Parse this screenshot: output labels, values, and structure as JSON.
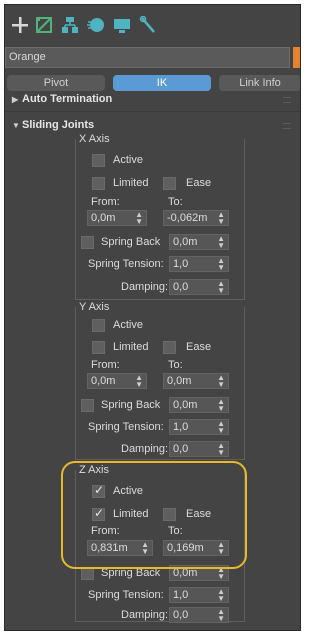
{
  "toolbar": {
    "icons": [
      "create-plus-icon",
      "modify-icon",
      "hierarchy-icon",
      "motion-icon",
      "display-icon",
      "utilities-wrench-icon"
    ]
  },
  "object": {
    "name": "Orange",
    "color": "#e5822d"
  },
  "tabs": [
    {
      "label": "Pivot"
    },
    {
      "label": "IK"
    },
    {
      "label": "Link Info"
    }
  ],
  "rollouts": {
    "auto_termination": {
      "title": "Auto Termination"
    },
    "sliding_joints": {
      "title": "Sliding Joints"
    }
  },
  "x_axis": {
    "title": "X Axis",
    "active_label": "Active",
    "limited_label": "Limited",
    "ease_label": "Ease",
    "from_label": "From:",
    "to_label": "To:",
    "from_value": "0,0m",
    "to_value": "-0,062m",
    "spring_back_label": "Spring Back",
    "spring_back_value": "0,0m",
    "spring_tension_label": "Spring Tension:",
    "spring_tension_value": "1,0",
    "damping_label": "Damping:",
    "damping_value": "0,0"
  },
  "y_axis": {
    "title": "Y Axis",
    "active_label": "Active",
    "limited_label": "Limited",
    "ease_label": "Ease",
    "from_label": "From:",
    "to_label": "To:",
    "from_value": "0,0m",
    "to_value": "0,0m",
    "spring_back_label": "Spring Back",
    "spring_back_value": "0,0m",
    "spring_tension_label": "Spring Tension:",
    "spring_tension_value": "1,0",
    "damping_label": "Damping:",
    "damping_value": "0,0"
  },
  "z_axis": {
    "title": "Z Axis",
    "active_label": "Active",
    "active_checked": true,
    "limited_label": "Limited",
    "limited_checked": true,
    "ease_label": "Ease",
    "from_label": "From:",
    "to_label": "To:",
    "from_value": "0,831m",
    "to_value": "0,169m",
    "spring_back_label": "Spring Back",
    "spring_back_value": "0,0m",
    "spring_tension_label": "Spring Tension:",
    "spring_tension_value": "1,0",
    "damping_label": "Damping:",
    "damping_value": "0,0"
  },
  "colors": {
    "panel": "#444444",
    "active_tab": "#5b9bd5",
    "highlight": "#e8b92a"
  }
}
